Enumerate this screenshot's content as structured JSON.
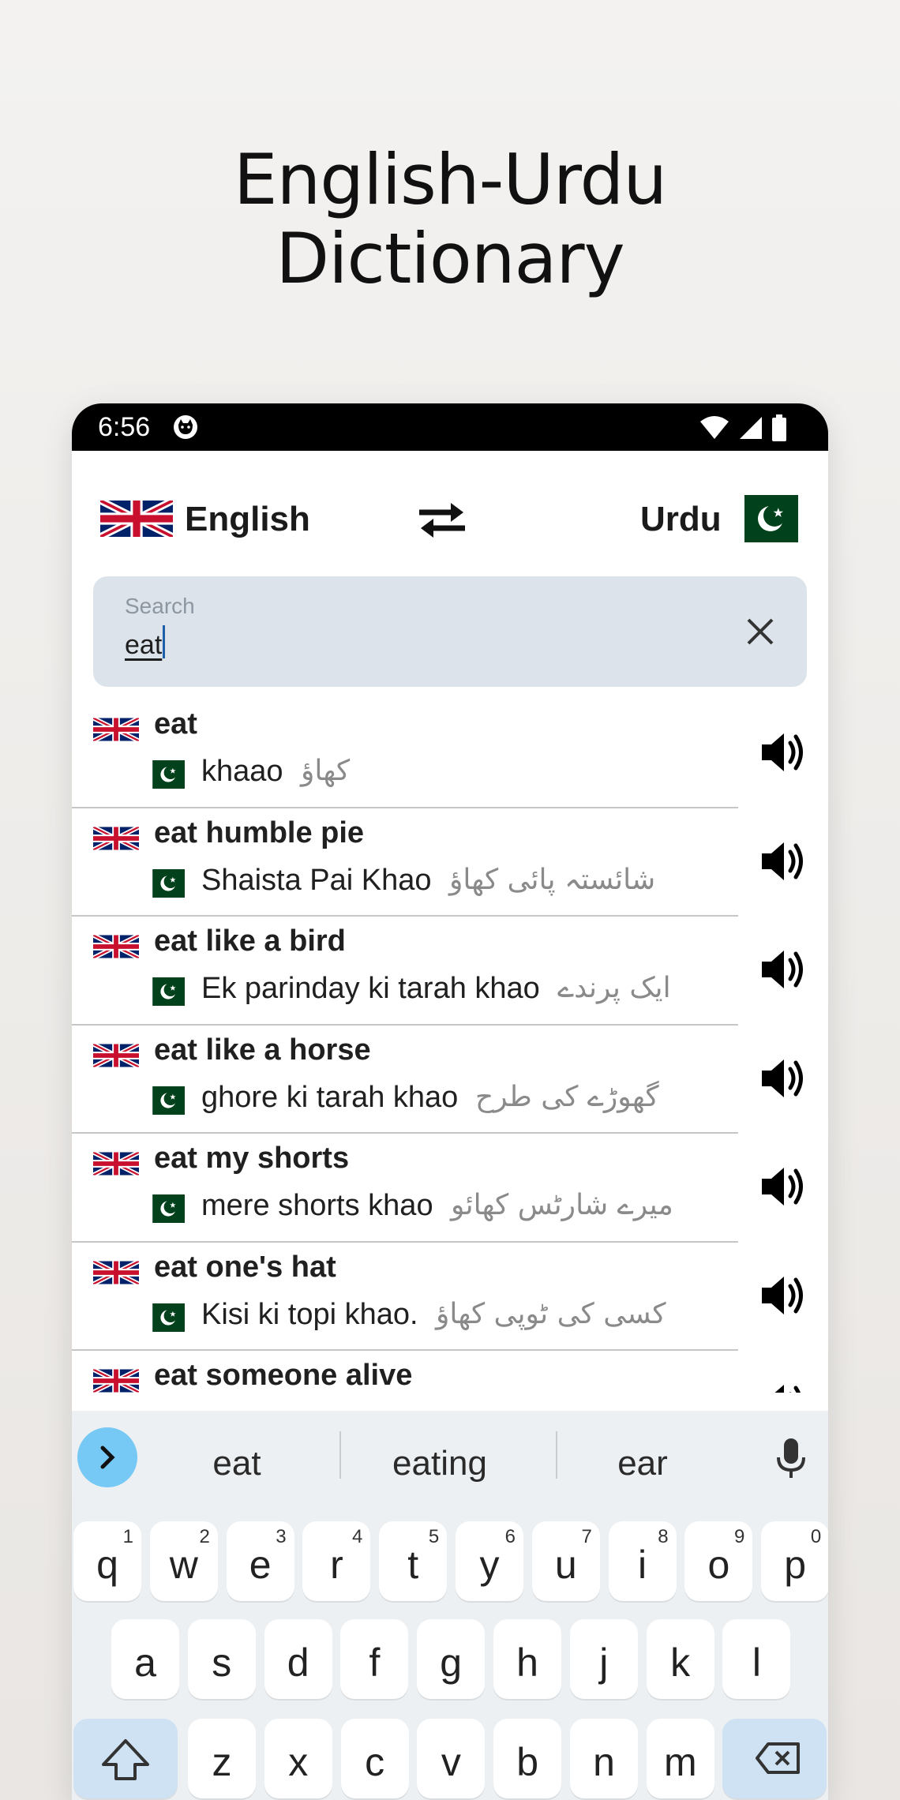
{
  "promo": {
    "title_line1": "English-Urdu",
    "title_line2": "Dictionary"
  },
  "statusbar": {
    "time": "6:56",
    "icons": [
      "cat-app-icon",
      "wifi-icon",
      "signal-icon",
      "battery-icon"
    ]
  },
  "language_bar": {
    "source_language": "English",
    "target_language": "Urdu",
    "source_flag": "uk-flag-icon",
    "target_flag": "pakistan-flag-icon",
    "swap_icon": "swap-arrows-icon"
  },
  "search": {
    "placeholder": "Search",
    "value": "eat",
    "clear_icon": "close-icon"
  },
  "results": [
    {
      "word": "eat",
      "roman": "khaao",
      "urdu": "کھاؤ"
    },
    {
      "word": "eat humble pie",
      "roman": "Shaista Pai Khao",
      "urdu": "شائستہ پائی کھاؤ"
    },
    {
      "word": "eat like a bird",
      "roman": "Ek parinday ki tarah khao",
      "urdu": "ایک پرندے"
    },
    {
      "word": "eat like a horse",
      "roman": "ghore ki tarah khao",
      "urdu": "گھوڑے کی طرح"
    },
    {
      "word": "eat my shorts",
      "roman": "mere shorts khao",
      "urdu": "میرے شارٹس کھائو"
    },
    {
      "word": "eat one's hat",
      "roman": "Kisi ki topi khao.",
      "urdu": "کسی کی ٹوپی کھاؤ"
    },
    {
      "word": "eat someone alive",
      "roman": "",
      "urdu": ""
    }
  ],
  "keyboard": {
    "suggestions": [
      "eat",
      "eating",
      "ear"
    ],
    "row1": [
      {
        "k": "q",
        "n": "1"
      },
      {
        "k": "w",
        "n": "2"
      },
      {
        "k": "e",
        "n": "3"
      },
      {
        "k": "r",
        "n": "4"
      },
      {
        "k": "t",
        "n": "5"
      },
      {
        "k": "y",
        "n": "6"
      },
      {
        "k": "u",
        "n": "7"
      },
      {
        "k": "i",
        "n": "8"
      },
      {
        "k": "o",
        "n": "9"
      },
      {
        "k": "p",
        "n": "0"
      }
    ],
    "row2": [
      "a",
      "s",
      "d",
      "f",
      "g",
      "h",
      "j",
      "k",
      "l"
    ],
    "row3": [
      "z",
      "x",
      "c",
      "v",
      "b",
      "n",
      "m"
    ]
  },
  "colors": {
    "search_bg": "#dde3ea",
    "suggest_expand": "#76c8f5",
    "special_key": "#cfe2f3",
    "pk_green": "#01411c"
  }
}
